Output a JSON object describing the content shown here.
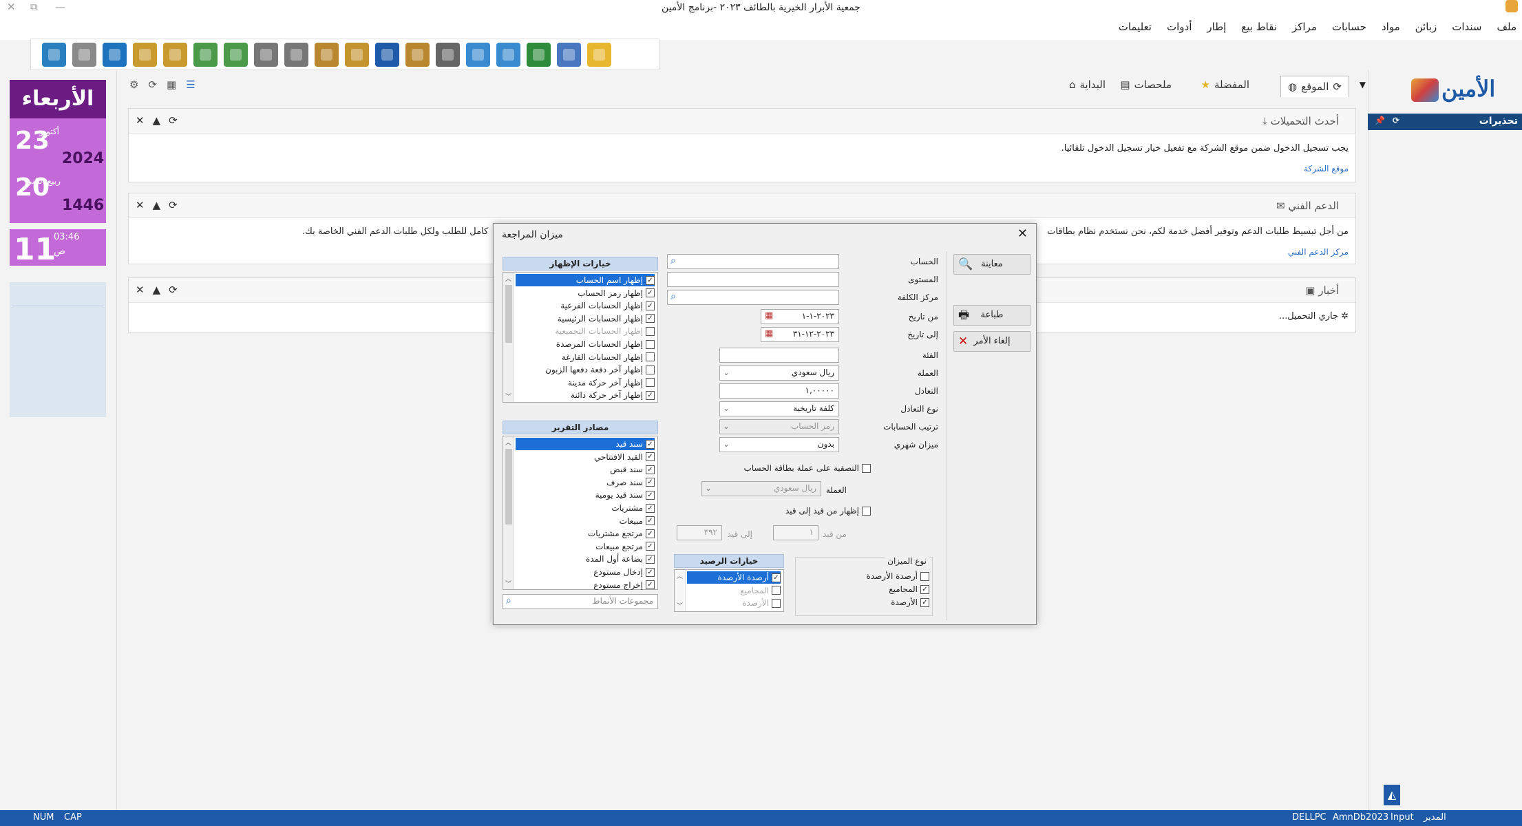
{
  "window": {
    "title": "جمعية الأبرار الخيرية بالطائف ٢٠٢٣ -برنامج الأمين"
  },
  "menu": [
    "ملف",
    "سندات",
    "زبائن",
    "مواد",
    "حسابات",
    "مراكز",
    "نقاط بيع",
    "إطار",
    "أدوات",
    "تعليمات"
  ],
  "toolbar": {
    "buttons": [
      {
        "name": "exit-icon",
        "color": "#2a7fbf"
      },
      {
        "name": "calculator-icon",
        "color": "#8a8a8a"
      },
      {
        "name": "refresh-icon",
        "color": "#1e73be"
      },
      {
        "name": "customers-icon",
        "color": "#c99a2e"
      },
      {
        "name": "users-icon",
        "color": "#c99a2e"
      },
      {
        "name": "pen-icon",
        "color": "#4a9a4a"
      },
      {
        "name": "edit-icon",
        "color": "#4a9a4a"
      },
      {
        "name": "receipt-icon",
        "color": "#777"
      },
      {
        "name": "payment-icon",
        "color": "#777"
      },
      {
        "name": "document-icon",
        "color": "#b8872e"
      },
      {
        "name": "balance-icon",
        "color": "#c4942e"
      },
      {
        "name": "book-icon",
        "color": "#1e5aa8"
      },
      {
        "name": "report-icon",
        "color": "#b8872e"
      },
      {
        "name": "write-icon",
        "color": "#666"
      },
      {
        "name": "chart-icon",
        "color": "#3a8ad0"
      },
      {
        "name": "form-icon",
        "color": "#3a8ad0"
      },
      {
        "name": "money-icon",
        "color": "#2e8b3c"
      },
      {
        "name": "tasks-icon",
        "color": "#4a78c0"
      },
      {
        "name": "folder-icon",
        "color": "#e8b730"
      }
    ]
  },
  "calendar": {
    "weekday": "الأربعاء",
    "greg_month": "أكتوبر",
    "greg_day": "23",
    "greg_year": "2024",
    "hijri_month": "ربيع الثاني",
    "hijri_day": "20",
    "hijri_year": "1446",
    "time": "03:46",
    "ampm": "ص",
    "time_day": "11"
  },
  "tabs": [
    {
      "label": "الموقع",
      "active": true
    },
    {
      "label": "المفضلة"
    },
    {
      "label": "ملحصات"
    },
    {
      "label": "البداية"
    }
  ],
  "panels": {
    "downloads": {
      "title": "أحدث التحميلات",
      "text": "يجب تسجيل الدخول ضمن موقع الشركة مع تفعيل خيار تسجيل الدخول تلقائيا.",
      "link": "موقع الشركة"
    },
    "support": {
      "title": "الدعم الفني",
      "text": "من أجل تبسيط طلبات الدعم وتوفير أفضل خدمة لكم، نحن نستخدم نظام بطاقات",
      "text2": "كامل للطلب ولكل طلبات الدعم الفني الخاصة بك.",
      "link": "مركز الدعم الفني"
    },
    "news": {
      "title": "أخبار",
      "loading": "جاري التحميل..."
    }
  },
  "right": {
    "header": "تحذيرات"
  },
  "logo": {
    "text": "الأمين"
  },
  "status": {
    "num": "NUM",
    "cap": "CAP",
    "pc": "DELLPC",
    "db": "AmnDb2023",
    "mode": "Input",
    "user": "المدير"
  },
  "dialog": {
    "title": "ميزان المراجعة",
    "fields": {
      "account": "الحساب",
      "level": "المستوى",
      "cost_center": "مركز الكلفة",
      "from_date": "من تاريخ",
      "from_date_val": "٢٠٢٣-١-١",
      "to_date": "إلى تاريخ",
      "to_date_val": "٢٠٢٣-١٢-٣١",
      "category": "الفئة",
      "currency": "العملة",
      "currency_val": "ريال سعودي",
      "rate": "التعادل",
      "rate_val": "١,٠٠٠٠٠",
      "rate_type": "نوع التعادل",
      "rate_type_val": "كلفة تاريخية",
      "sort": "ترتيب الحسابات",
      "sort_val": "رمز الحساب",
      "monthly": "ميزان شهري",
      "monthly_val": "بدون",
      "filter_card": "التصفية على عملة بطاقة الحساب",
      "currency2": "العملة",
      "currency2_val": "ريال سعودي",
      "show_entries": "إظهار من قيد إلى قيد",
      "from_entry": "من قيد",
      "from_entry_val": "١",
      "to_entry": "إلى قيد",
      "to_entry_val": "٣٩٢"
    },
    "buttons": {
      "preview": "معاينة",
      "print": "طباعة",
      "cancel": "إلغاء الأمر"
    },
    "display_options": {
      "header": "خيارات الإظهار",
      "items": [
        {
          "label": "إظهار اسم الحساب",
          "checked": true,
          "selected": true
        },
        {
          "label": "إظهار رمز الحساب",
          "checked": true
        },
        {
          "label": "إظهار الحسابات الفرعية",
          "checked": true
        },
        {
          "label": "إظهار الحسابات الرئيسية",
          "checked": true
        },
        {
          "label": "إظهار الحسابات التجميعية",
          "checked": false,
          "dim": true
        },
        {
          "label": "إظهار الحسابات المرصدة",
          "checked": false
        },
        {
          "label": "إظهار الحسابات الفارغة",
          "checked": false
        },
        {
          "label": "إظهار آخر دفعة دفعها الزبون",
          "checked": false
        },
        {
          "label": "إظهار آخر حركة مدينة",
          "checked": false
        },
        {
          "label": "إظهار آخر حركة دائنة",
          "checked": true
        }
      ]
    },
    "sources": {
      "header": "مصادر التقرير",
      "items": [
        {
          "label": "سند قيد",
          "checked": true,
          "selected": true
        },
        {
          "label": "القيد الافتتاحي",
          "checked": true
        },
        {
          "label": "سند قبض",
          "checked": true
        },
        {
          "label": "سند صرف",
          "checked": true
        },
        {
          "label": "سند قيد يومية",
          "checked": true
        },
        {
          "label": "مشتريات",
          "checked": true
        },
        {
          "label": "مبيعات",
          "checked": true
        },
        {
          "label": "مرتجع مشتريات",
          "checked": true
        },
        {
          "label": "مرتجع مبيعات",
          "checked": true
        },
        {
          "label": "بضاعة أول المدة",
          "checked": true
        },
        {
          "label": "إدخال مستودع",
          "checked": true
        },
        {
          "label": "إخراج مستودع",
          "checked": true
        }
      ],
      "search_placeholder": "مجموعات الأنماط"
    },
    "balance_options": {
      "header": "خيارات الرصيد",
      "items": [
        {
          "label": "أرصدة الأرصدة",
          "checked": true,
          "selected": true
        },
        {
          "label": "المجاميع",
          "checked": false
        },
        {
          "label": "الأرصدة",
          "checked": false
        }
      ]
    },
    "balance_type": {
      "header": "نوع الميزان",
      "items": [
        {
          "label": "أرصدة الأرصدة",
          "checked": false
        },
        {
          "label": "المجاميع",
          "checked": true
        },
        {
          "label": "الأرصدة",
          "checked": true
        }
      ]
    }
  }
}
